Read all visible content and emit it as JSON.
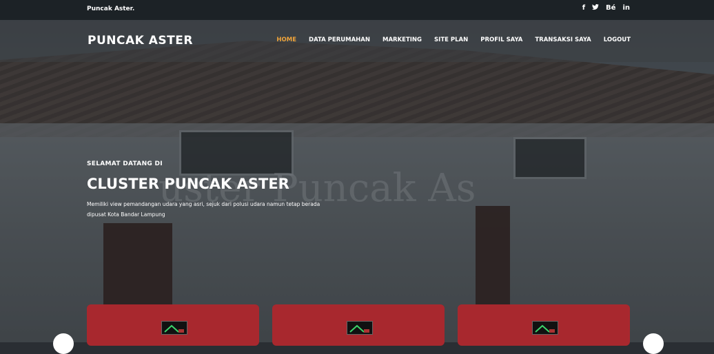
{
  "topbar": {
    "brand": "Puncak Aster.",
    "social": {
      "facebook": "f",
      "twitter": "♥",
      "behance": "Bé",
      "linkedin": "in"
    }
  },
  "nav": {
    "logo": "PUNCAK ASTER",
    "items": [
      {
        "label": "HOME",
        "active": true
      },
      {
        "label": "DATA PERUMAHAN"
      },
      {
        "label": "MARKETING"
      },
      {
        "label": "SITE PLAN"
      },
      {
        "label": "PROFIL SAYA"
      },
      {
        "label": "TRANSAKSI SAYA"
      },
      {
        "label": "LOGOUT"
      }
    ]
  },
  "hero": {
    "kicker": "SELAMAT DATANG DI",
    "title": "CLUSTER PUNCAK ASTER",
    "description": "Memiliki view pemandangan udara yang asri, sejuk dari polusi udara namun tetap berada dipusat Kota Bandar Lampung",
    "background_text": "uster Puncak As"
  },
  "colors": {
    "accent": "#f0a43a",
    "card": "#a8282e",
    "topbar": "#1c2226"
  }
}
